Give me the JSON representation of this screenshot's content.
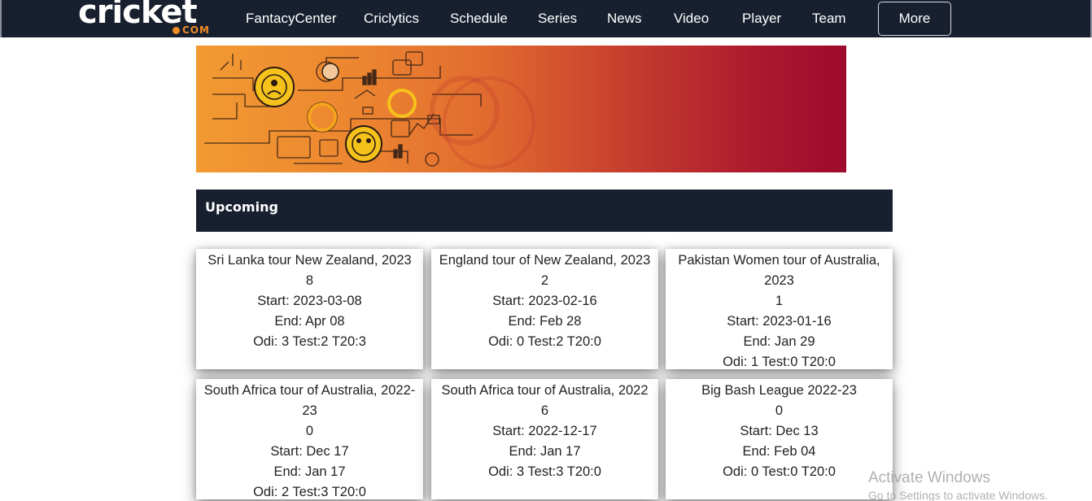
{
  "header": {
    "logo_word": "cricket",
    "logo_suffix": "COM",
    "nav": [
      {
        "label": "FantacyCenter"
      },
      {
        "label": "Criclytics"
      },
      {
        "label": "Schedule"
      },
      {
        "label": "Series"
      },
      {
        "label": "News"
      },
      {
        "label": "Video"
      },
      {
        "label": "Player"
      },
      {
        "label": "Team"
      }
    ],
    "more_label": "More"
  },
  "colors": {
    "navbar_bg": "#18202f",
    "banner_start": "#f29a32",
    "banner_end": "#9d0a2c",
    "accent_orange": "#f08a24",
    "accent_yellow": "#f5c21b"
  },
  "section": {
    "title": "Upcoming"
  },
  "cards": [
    {
      "name": "Sri Lanka tour New Zealand, 2023",
      "count": "8",
      "start": "Start: 2023-03-08",
      "end": "End: Apr 08",
      "formats": "Odi: 3 Test:2 T20:3"
    },
    {
      "name": "England tour of New Zealand, 2023",
      "count": "2",
      "start": "Start: 2023-02-16",
      "end": "End: Feb 28",
      "formats": "Odi: 0 Test:2 T20:0"
    },
    {
      "name": "Pakistan Women tour of Australia, 2023",
      "count": "1",
      "start": "Start: 2023-01-16",
      "end": "End: Jan 29",
      "formats": "Odi: 1 Test:0 T20:0"
    },
    {
      "name": "South Africa tour of Australia, 2022-23",
      "count": "0",
      "start": "Start: Dec 17",
      "end": "End: Jan 17",
      "formats": "Odi: 2 Test:3 T20:0"
    },
    {
      "name": "South Africa tour of Australia, 2022",
      "count": "6",
      "start": "Start: 2022-12-17",
      "end": "End: Jan 17",
      "formats": "Odi: 3 Test:3 T20:0"
    },
    {
      "name": "Big Bash League 2022-23",
      "count": "0",
      "start": "Start: Dec 13",
      "end": "End: Feb 04",
      "formats": "Odi: 0 Test:0 T20:0"
    }
  ],
  "watermark": {
    "title": "Activate Windows",
    "subtitle": "Go to Settings to activate Windows."
  }
}
